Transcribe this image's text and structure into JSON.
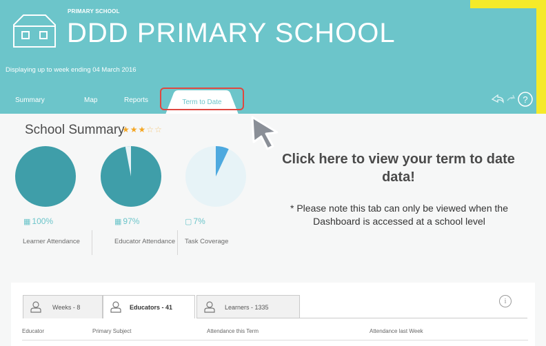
{
  "header": {
    "level_label": "PRIMARY SCHOOL",
    "school_name": "DDD PRIMARY SCHOOL",
    "display_info": "Displaying up to week ending 04 March 2016",
    "tabs": [
      "Summary",
      "Map",
      "Reports",
      "Term to Date"
    ],
    "active_tab": "Term to Date",
    "icons": [
      "back-icon",
      "refresh-icon",
      "help-icon"
    ]
  },
  "summary": {
    "title": "School Summary",
    "stars_filled": 3,
    "stars_total": 5,
    "metrics": [
      {
        "value": "100%",
        "label": "Learner Attendance",
        "fraction": 1.0,
        "icon": "calendar-icon"
      },
      {
        "value": "97%",
        "label": "Educator Attendance",
        "fraction": 0.97,
        "icon": "calendar-icon"
      },
      {
        "value": "7%",
        "label": "Task Coverage",
        "fraction": 0.07,
        "icon": "clipboard-icon"
      }
    ]
  },
  "callout": {
    "heading": "Click here to view your term to date data!",
    "note": "* Please note this tab can only be viewed when the Dashboard is accessed at a school level"
  },
  "table": {
    "tabs": [
      {
        "label": "Weeks - 8",
        "icon": "user-icon"
      },
      {
        "label": "Educators - 41",
        "icon": "user-icon"
      },
      {
        "label": "Learners - 1335",
        "icon": "user-icon"
      }
    ],
    "active_tab": "Educators - 41",
    "columns": [
      "Educator",
      "Primary Subject",
      "Attendance this Term",
      "Attendance last Week"
    ]
  },
  "colors": {
    "teal": "#6cc5ca",
    "pie_main": "#3f9ea9",
    "pie_light": "#e7f3f7",
    "pie_accent": "#4da9df",
    "highlight": "#e0473f",
    "yellow": "#f5ea2a",
    "star": "#f4a623"
  }
}
